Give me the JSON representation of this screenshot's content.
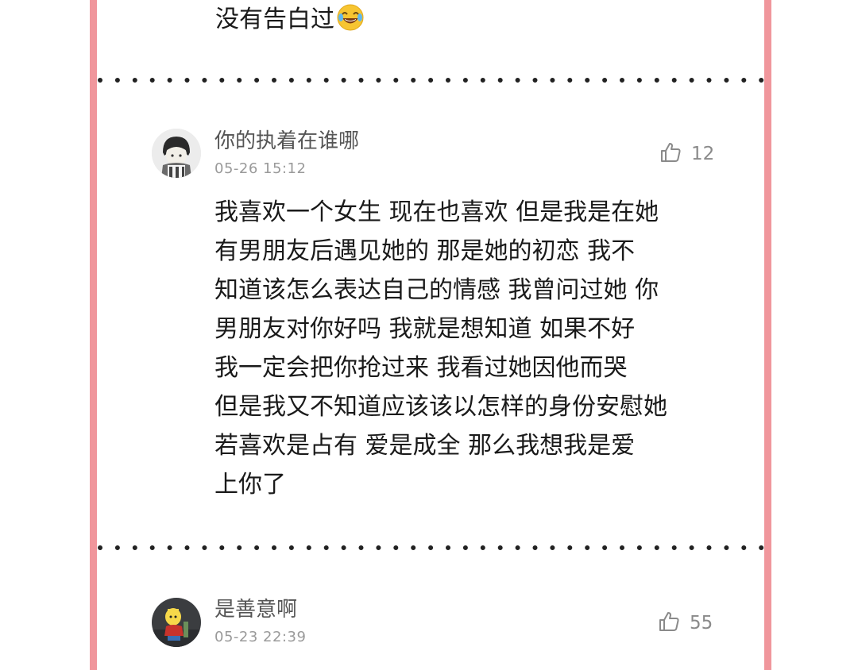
{
  "comments": [
    {
      "body": "没有告白过",
      "emoji": "laughing-tears-emoji"
    },
    {
      "username": "你的执着在谁哪",
      "timestamp": "05-26 15:12",
      "likes": "12",
      "body": "我喜欢一个女生 现在也喜欢  但是我是在她\n有男朋友后遇见她的  那是她的初恋  我不\n知道该怎么表达自己的情感  我曾问过她 你\n男朋友对你好吗  我就是想知道  如果不好\n我一定会把你抢过来     我看过她因他而哭\n但是我又不知道应该该以怎样的身份安慰她\n若喜欢是占有  爱是成全  那么我想我是爱\n上你了",
      "avatar": "cartoon-avatar"
    },
    {
      "username": "是善意啊",
      "timestamp": "05-23 22:39",
      "likes": "55",
      "avatar": "cartoon-avatar"
    }
  ],
  "icons": {
    "like": "thumbs-up-icon"
  },
  "colors": {
    "frame": "#f0969c",
    "username": "#555555",
    "timestamp": "#9a9a9a",
    "body": "#1a1a1a"
  }
}
